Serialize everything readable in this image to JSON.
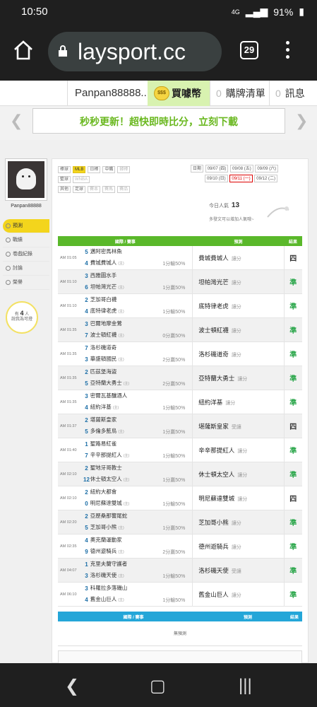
{
  "status": {
    "time": "10:50",
    "network": "4G",
    "battery": "91%"
  },
  "browser": {
    "url": "playsport.cc",
    "url_display": "laysport.cc",
    "tab_count": "29"
  },
  "topnav": {
    "username": "Panpan88888...",
    "coin_icon_text": "$$$",
    "buy_label": "買噱幣",
    "cart_count": "0",
    "cart_label": "購牌清單",
    "msg_count": "0",
    "msg_label": "訊息"
  },
  "banner": {
    "text": "秒秒更新！超快即時比分，立刻下載"
  },
  "sidebar": {
    "username": "Panpan88888",
    "menu": [
      "預測",
      "戰績",
      "卷戲紀錄",
      "討論",
      "榮譽"
    ],
    "bulb_prefix": "有",
    "bulb_count": "4",
    "bulb_unit": "人",
    "bulb_suffix": "說我為可燈"
  },
  "filters": {
    "row1_label": "棒球",
    "row1": [
      "MLB",
      "日棒",
      "中職",
      "韓棒"
    ],
    "row2_label": "籃球",
    "row2": [
      "WNBA"
    ],
    "row3_label": "其他",
    "row3": [
      "足球",
      "賽本",
      "賽馬",
      "賽品"
    ],
    "dates_label": "日期",
    "dates": [
      "09/07 (四)",
      "09/08 (五)",
      "09/09 (六)",
      "09/10 (日)",
      "09/11 (一)",
      "09/12 (二)"
    ],
    "selected_date": "09/11 (一)"
  },
  "today": {
    "label": "今日人氣",
    "value": "13",
    "hint": "多發文可以增加人氣哦~"
  },
  "table": {
    "headers": [
      "國際 / 賽事",
      "預測",
      "結果"
    ],
    "rows": [
      {
        "time": "AM 01:05",
        "s1": "5",
        "t1": "邁阿密馬林魚",
        "s2": "4",
        "t2": "費城費城人",
        "m2": "(主)",
        "odds": "1分輸50%",
        "pick": "費城費城人",
        "kind": "讓分",
        "res": "四",
        "rc": "draw"
      },
      {
        "time": "AM 01:10",
        "s1": "3",
        "t1": "西雅圖水手",
        "s2": "6",
        "t2": "坦帕灣光芒",
        "m2": "(主)",
        "odds": "1分贏50%",
        "pick": "坦帕灣光芒",
        "kind": "讓分",
        "res": "準",
        "rc": "win"
      },
      {
        "time": "AM 01:10",
        "s1": "2",
        "t1": "芝加哥白襪",
        "s2": "4",
        "t2": "底特律老虎",
        "m2": "(主)",
        "odds": "1分輸50%",
        "pick": "底特律老虎",
        "kind": "讓分",
        "res": "準",
        "rc": "win"
      },
      {
        "time": "AM 01:35",
        "s1": "3",
        "t1": "巴爾地摩金鶯",
        "s2": "7",
        "t2": "波士頓紅襪",
        "m2": "(主)",
        "odds": "0分贏50%",
        "pick": "波士頓紅襪",
        "kind": "讓分",
        "res": "準",
        "rc": "win"
      },
      {
        "time": "AM 01:35",
        "s1": "7",
        "t1": "洛杉磯道奇",
        "s2": "3",
        "t2": "華盛頓國民",
        "m2": "(主)",
        "odds": "2分贏50%",
        "pick": "洛杉磯道奇",
        "kind": "讓分",
        "res": "準",
        "rc": "win"
      },
      {
        "time": "AM 01:35",
        "s1": "2",
        "t1": "匹茲堡海盜",
        "s2": "5",
        "t2": "亞特蘭大勇士",
        "m2": "(主)",
        "odds": "2分贏50%",
        "pick": "亞特蘭大勇士",
        "kind": "讓分",
        "res": "準",
        "rc": "win"
      },
      {
        "time": "AM 01:35",
        "s1": "3",
        "t1": "密爾瓦基釀酒人",
        "s2": "4",
        "t2": "紐約洋基",
        "m2": "(主)",
        "odds": "1分輸50%",
        "pick": "紐約洋基",
        "kind": "讓分",
        "res": "準",
        "rc": "win"
      },
      {
        "time": "AM 01:37",
        "s1": "2",
        "t1": "堪薩斯皇家",
        "s2": "5",
        "t2": "多倫多藍鳥",
        "m2": "(主)",
        "odds": "1分贏50%",
        "pick": "堪薩斯皇家",
        "kind": "受讓",
        "res": "四",
        "rc": "draw"
      },
      {
        "time": "AM 01:40",
        "s1": "1",
        "t1": "聖路易紅雀",
        "s2": "7",
        "t2": "辛辛那提紅人",
        "m2": "(主)",
        "odds": "1分輸50%",
        "pick": "辛辛那提紅人",
        "kind": "讓分",
        "res": "準",
        "rc": "win"
      },
      {
        "time": "AM 02:10",
        "s1": "2",
        "t1": "聖地牙哥教士",
        "s2": "12",
        "t2": "休士頓太空人",
        "m2": "(主)",
        "odds": "1分贏50%",
        "pick": "休士頓太空人",
        "kind": "讓分",
        "res": "準",
        "rc": "win"
      },
      {
        "time": "AM 02:10",
        "s1": "2",
        "t1": "紐約大都會",
        "s2": "0",
        "t2": "明尼蘇達雙城",
        "m2": "(主)",
        "odds": "1分輸50%",
        "pick": "明尼蘇達雙城",
        "kind": "讓分",
        "res": "四",
        "rc": "draw"
      },
      {
        "time": "AM 02:20",
        "s1": "2",
        "t1": "亞歷桑那響尾蛇",
        "s2": "5",
        "t2": "芝加哥小熊",
        "m2": "(主)",
        "odds": "1分贏50%",
        "pick": "芝加哥小熊",
        "kind": "讓分",
        "res": "準",
        "rc": "win"
      },
      {
        "time": "AM 02:35",
        "s1": "4",
        "t1": "奧克蘭運動家",
        "s2": "9",
        "t2": "德州遊騎兵",
        "m2": "(主)",
        "odds": "2分贏50%",
        "pick": "德州遊騎兵",
        "kind": "讓分",
        "res": "準",
        "rc": "win"
      },
      {
        "time": "AM 04:07",
        "s1": "1",
        "t1": "克里夫蘭守護者",
        "s2": "3",
        "t2": "洛杉磯天使",
        "m2": "(主)",
        "odds": "1分輸50%",
        "pick": "洛杉磯天使",
        "kind": "受讓",
        "res": "準",
        "rc": "win"
      },
      {
        "time": "AM 06:10",
        "s1": "3",
        "t1": "科羅拉多落磯山",
        "s2": "4",
        "t2": "舊金山巨人",
        "m2": "(主)",
        "odds": "1分輸50%",
        "pick": "舊金山巨人",
        "kind": "讓分",
        "res": "準",
        "rc": "win"
      }
    ]
  },
  "table2": {
    "headers": [
      "國際 / 賽事",
      "預測",
      "結果"
    ],
    "empty": "無預測"
  }
}
